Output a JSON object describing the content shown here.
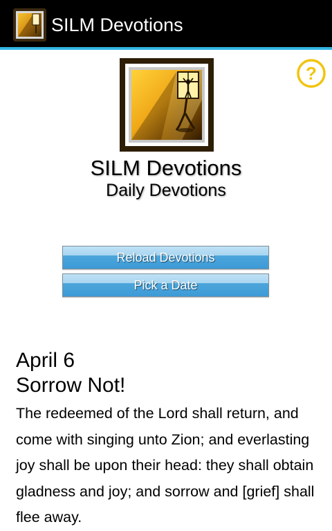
{
  "action_bar": {
    "title": "SILM Devotions",
    "icon": "app-logo-icon",
    "background": "#000000",
    "accent": "#33b5e5"
  },
  "header": {
    "logo": "silm-logo-icon",
    "help_icon": "help-icon",
    "help_color": "#f1c40f",
    "title": "SILM Devotions",
    "subtitle": "Daily Devotions"
  },
  "buttons": {
    "reload_label": "Reload Devotions",
    "pick_label": "Pick a Date"
  },
  "devotion": {
    "date": "April 6",
    "title": "Sorrow Not!",
    "body": "The redeemed of the Lord shall return, and come with singing unto Zion; and everlasting joy shall be upon their head: they shall obtain gladness and joy; and sorrow and [grief] shall flee away."
  }
}
